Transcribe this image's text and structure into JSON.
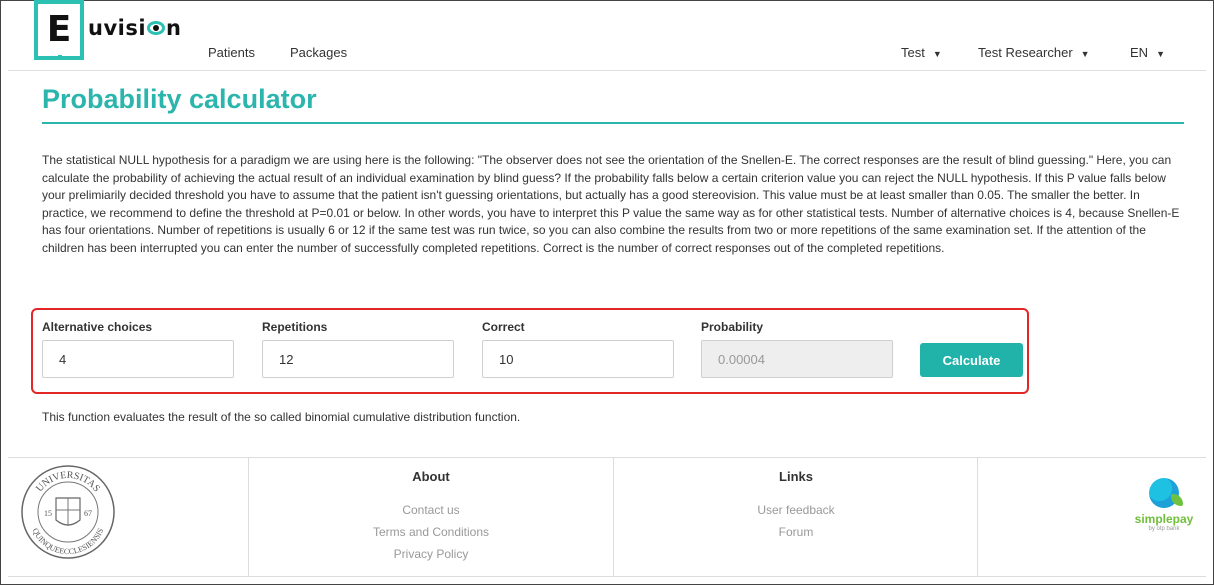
{
  "brand": {
    "logo_letter": "E",
    "logo_text_before": "uvisi",
    "logo_text_after": "n"
  },
  "nav": {
    "left": [
      {
        "label": "Patients"
      },
      {
        "label": "Packages"
      }
    ],
    "right": [
      {
        "label": "Test"
      },
      {
        "label": "Test Researcher"
      },
      {
        "label": "EN"
      }
    ]
  },
  "page": {
    "title": "Probability calculator",
    "intro": "The statistical NULL hypothesis for a paradigm we are using here is the following: \"The observer does not see the orientation of the Snellen-E. The correct responses are the result of blind guessing.\" Here, you can calculate the probability of achieving the actual result of an individual examination by blind guess? If the probability falls below a certain criterion value you can reject the NULL hypothesis. If this P value falls below your prelimiarily decided threshold you have to assume that the patient isn't guessing orientations, but actually has a good stereovision. This value must be at least smaller than 0.05. The smaller the better. In practice, we recommend to define the threshold at P=0.01 or below. In other words, you have to interpret this P value the same way as for other statistical tests. Number of alternative choices is 4, because Snellen-E has four orientations. Number of repetitions is usually 6 or 12 if the same test was run twice, so you can also combine the results from two or more repetitions of the same examination set. If the attention of the children has been interrupted you can enter the number of successfully completed repetitions. Correct is the number of correct responses out of the completed repetitions.",
    "note": "This function evaluates the result of the so called binomial cumulative distribution function."
  },
  "calculator": {
    "alternatives": {
      "label": "Alternative choices",
      "value": "4"
    },
    "repetitions": {
      "label": "Repetitions",
      "value": "12"
    },
    "correct": {
      "label": "Correct",
      "value": "10"
    },
    "probability": {
      "label": "Probability",
      "value": "0.00004"
    },
    "button_label": "Calculate"
  },
  "footer": {
    "about": {
      "heading": "About",
      "links": [
        "Contact us",
        "Terms and Conditions",
        "Privacy Policy"
      ]
    },
    "links": {
      "heading": "Links",
      "links": [
        "User feedback",
        "Forum"
      ]
    },
    "seal": {
      "top_text": "UNIVERSITAS",
      "bottom_text": "QUINQUEECCLESIENSIS",
      "year_left": "15",
      "year_right": "67"
    },
    "payment": {
      "name": "simplepay",
      "sub": "by otp bank"
    }
  },
  "colors": {
    "accent": "#2cb5ad",
    "highlight_border": "#e32626",
    "button": "#21b3a9"
  }
}
